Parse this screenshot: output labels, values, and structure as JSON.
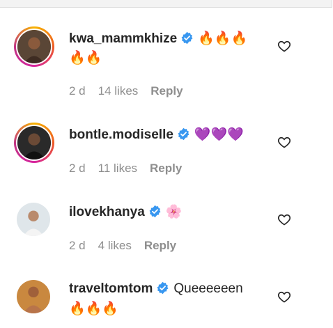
{
  "comments": [
    {
      "username": "kwa_mammkhize",
      "text_line1": "🔥🔥🔥",
      "text_line2": "🔥🔥",
      "time": "2 d",
      "likes": "14 likes",
      "reply": "Reply",
      "avatar": "story-ring-avatar"
    },
    {
      "username": "bontle.modiselle",
      "text_line1": "💜💜💜",
      "time": "2 d",
      "likes": "11 likes",
      "reply": "Reply",
      "avatar": "story-ring-avatar"
    },
    {
      "username": "ilovekhanya",
      "text_line1": "🌸",
      "time": "2 d",
      "likes": "4 likes",
      "reply": "Reply",
      "avatar": "plain-avatar"
    },
    {
      "username": "traveltomtom",
      "text_line1": "Queeeeeen",
      "text_line2": "🔥🔥🔥",
      "avatar": "plain-avatar"
    }
  ],
  "icons": {
    "verified": "verified-badge-icon",
    "like": "heart-outline-icon"
  },
  "colors": {
    "verified_blue": "#3897f0",
    "meta_gray": "#8e8e8e",
    "text": "#262626"
  }
}
